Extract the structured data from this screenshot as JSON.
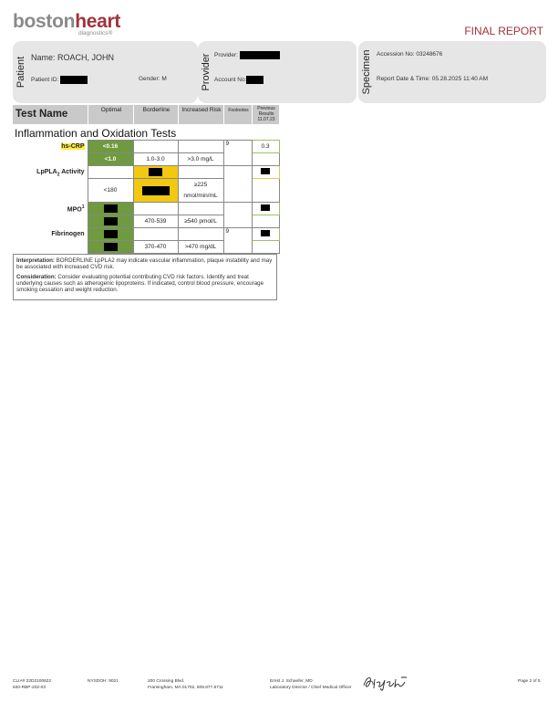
{
  "logo": {
    "part1": "boston",
    "part2": "heart",
    "sub": "diagnostics®"
  },
  "report_title": "FINAL REPORT",
  "patient": {
    "section": "Patient",
    "name_label": "Name:",
    "name": "ROACH, JOHN",
    "id_label": "Patient ID:",
    "gender_label": "Gender:",
    "gender": "M"
  },
  "provider": {
    "section": "Provider",
    "provider_label": "Provider:",
    "account_label": "Account No:"
  },
  "specimen": {
    "section": "Specimen",
    "accession_label": "Accession No:",
    "accession": "03248676",
    "date_label": "Report Date & Time:",
    "date": "05.28.2025 11:40 AM"
  },
  "table_header": {
    "test_name": "Test Name",
    "optimal": "Optimal",
    "borderline": "Borderline",
    "increased": "Increased Risk",
    "footnotes": "Footnotes",
    "previous_l1": "Previous",
    "previous_l2": "Results",
    "previous_l3": "11.07.23"
  },
  "section_title": "Inflammation and Oxidation Tests",
  "tests": {
    "hscrp": {
      "name": "hs-CRP",
      "optimal_result": "<0.16",
      "footnote": "9",
      "previous": "0.3",
      "optimal_range": "<1.0",
      "borderline_range": "1.0-3.0",
      "increased_range": ">3.0 mg/L"
    },
    "lppla2": {
      "name_a": "LpPLA",
      "name_sub": "2",
      "name_b": " Activity",
      "optimal_range": "<180",
      "increased_range_l1": "≥225",
      "increased_range_l2": "nmol/min/mL"
    },
    "mpo": {
      "name": "MPO",
      "sup": "1",
      "borderline_range": "470-539",
      "increased_range": "≥540 pmol/L"
    },
    "fibrinogen": {
      "name": "Fibrinogen",
      "footnote": "9",
      "borderline_range": "370-470",
      "increased_range": ">470 mg/dL"
    }
  },
  "notes": {
    "interp_label": "Interpretation:",
    "interp_text": " BORDERLINE LpPLA2 may indicate vascular inflammation, plaque instability and may be associated with increased CVD risk.",
    "consid_label": "Consideration:",
    "consid_text": " Consider evaluating potential contributing CVD risk factors. Identify and treat underlying causes such as atherogenic lipoproteins. If indicated, control blood pressure, encourage smoking cessation and weight reduction."
  },
  "footer": {
    "clia": "CLIA# 22D2100622",
    "cap": "840-RBP-202-03",
    "nysdoh": "NYSDOH: 9021",
    "addr1": "200 Crossing Blvd.",
    "addr2": "Framingham,    MA 01702, 508.877.8711",
    "director1": "Ernst J. Schaefer, MD",
    "director2": "Laboratory Director / Chief Medical Officer",
    "page": "Page 2 of 5"
  },
  "colors": {
    "optimal_green": "#6f9a3f",
    "borderline_yellow": "#f2c811",
    "brand_red": "#a2323a"
  }
}
